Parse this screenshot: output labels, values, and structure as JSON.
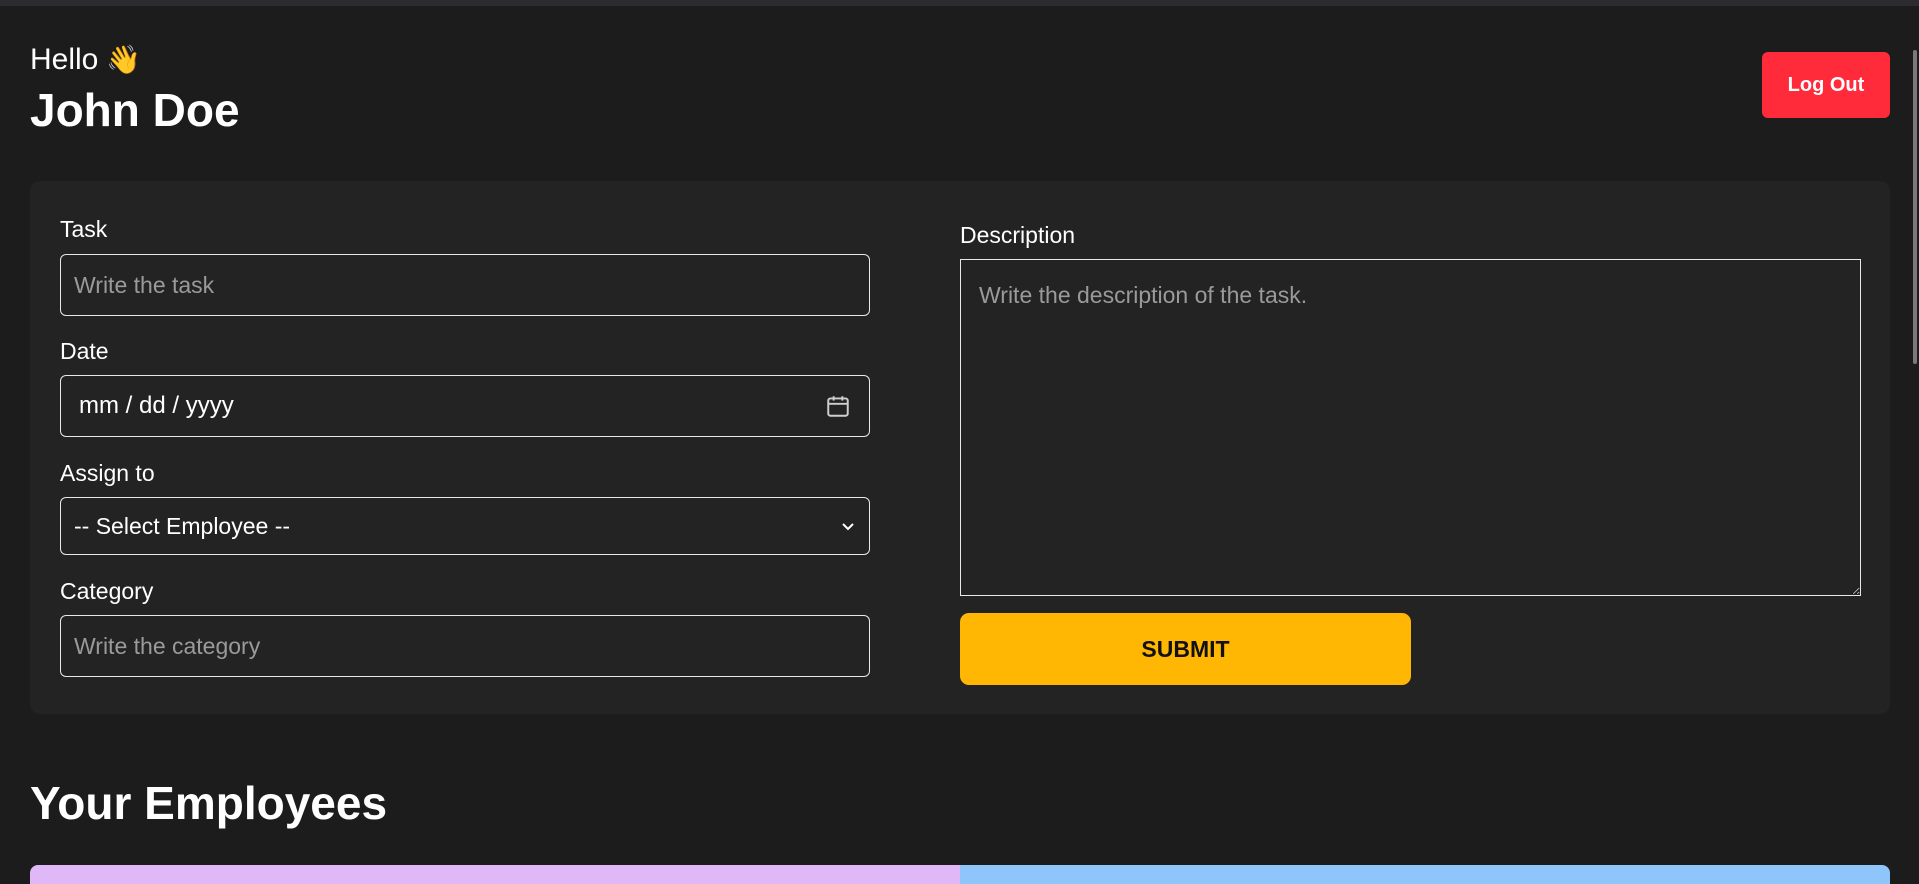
{
  "header": {
    "greeting": "Hello",
    "wave_emoji": "👋",
    "user_name": "John Doe",
    "logout_label": "Log Out"
  },
  "form": {
    "task": {
      "label": "Task",
      "placeholder": "Write the task"
    },
    "date": {
      "label": "Date",
      "display_value": "mm / dd / yyyy"
    },
    "assign": {
      "label": "Assign to",
      "selected": "-- Select Employee --"
    },
    "category": {
      "label": "Category",
      "placeholder": "Write the category"
    },
    "description": {
      "label": "Description",
      "placeholder": "Write the description of the task."
    },
    "submit_label": "SUBMIT"
  },
  "employees": {
    "title": "Your Employees",
    "cards": [
      {
        "color": "#e0b8f8"
      },
      {
        "color": "#8ec5fa"
      }
    ]
  },
  "colors": {
    "background": "#1c1c1c",
    "card": "#232323",
    "logout": "#ff2b3a",
    "submit": "#ffb703"
  }
}
